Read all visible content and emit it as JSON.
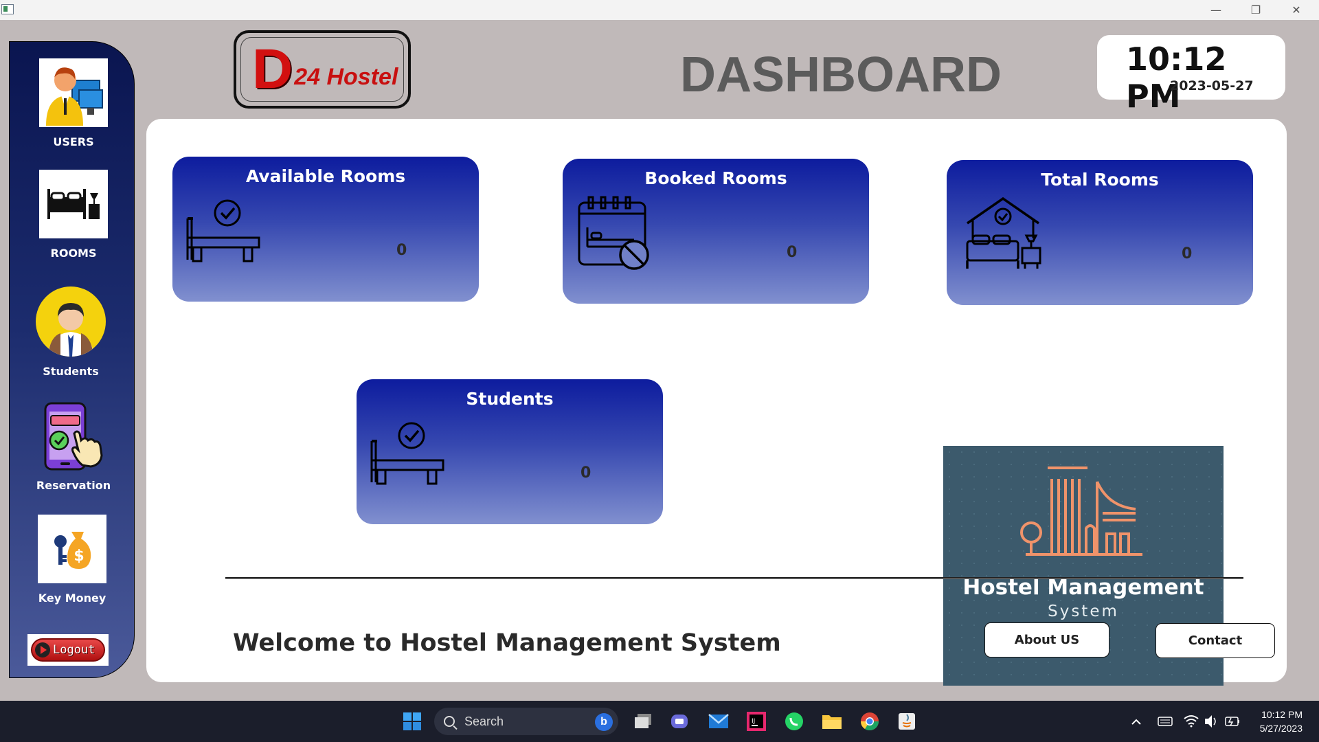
{
  "window": {
    "minimize_glyph": "—",
    "restore_glyph": "❐",
    "close_glyph": "✕"
  },
  "sidebar": {
    "items": [
      {
        "label": "USERS",
        "icon": "users-icon"
      },
      {
        "label": "ROOMS",
        "icon": "bed-room-icon"
      },
      {
        "label": "Students",
        "icon": "student-avatar-icon"
      },
      {
        "label": "Reservation",
        "icon": "reservation-phone-icon"
      },
      {
        "label": "Key Money",
        "icon": "key-money-icon"
      }
    ],
    "logout_label": "Logout"
  },
  "header": {
    "logo_letter": "D",
    "logo_text": "24 Hostel",
    "title": "DASHBOARD",
    "clock_time": "10:12 PM",
    "clock_date": "2023-05-27"
  },
  "cards": [
    {
      "title": "Available Rooms",
      "value": "0",
      "icon": "bed-check-icon"
    },
    {
      "title": "Booked Rooms",
      "value": "0",
      "icon": "calendar-bed-blocked-icon"
    },
    {
      "title": "Total  Rooms",
      "value": "0",
      "icon": "house-bed-icon"
    },
    {
      "title": "Students",
      "value": "0",
      "icon": "bed-check-icon"
    }
  ],
  "brand": {
    "line1": "Hostel Management",
    "line2": "System"
  },
  "footer": {
    "welcome": "Welcome to  Hostel Management System",
    "about_label": "About US",
    "contact_label": "Contact"
  },
  "taskbar": {
    "search_placeholder": "Search",
    "bing_letter": "b",
    "clock_time": "10:12 PM",
    "clock_date": "5/27/2023",
    "apps": [
      "start-icon",
      "task-view-icon",
      "teams-chat-icon",
      "mail-icon",
      "intellij-icon",
      "whatsapp-icon",
      "file-explorer-icon",
      "chrome-icon",
      "java-app-icon"
    ]
  },
  "colors": {
    "card_top": "#0d1c9e",
    "card_bottom": "#8190cf",
    "sidebar_top": "#0a1550",
    "brand_bg": "#3c5a6c",
    "brand_accent": "#f0936a"
  }
}
